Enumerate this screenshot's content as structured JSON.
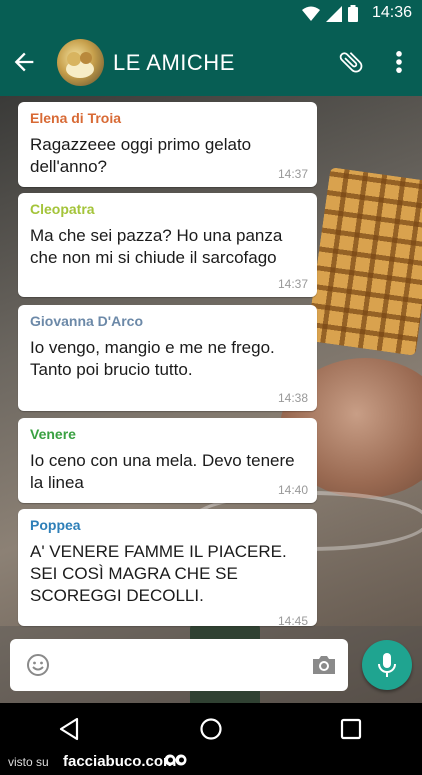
{
  "status_bar": {
    "time": "14:36",
    "icons": [
      "wifi-icon",
      "signal-icon",
      "battery-icon"
    ]
  },
  "header": {
    "title": "LE AMICHE",
    "icons": [
      "back-arrow-icon",
      "group-avatar",
      "attach-icon",
      "more-vert-icon"
    ]
  },
  "messages": [
    {
      "sender": "Elena di Troia",
      "sender_color": "#d86a35",
      "text": "Ragazzeee oggi primo gelato dell'anno?",
      "time": "14:37"
    },
    {
      "sender": "Cleopatra",
      "sender_color": "#a4c43a",
      "text": "Ma che sei pazza? Ho una panza che non mi si chiude il sarcofago",
      "time": "14:37"
    },
    {
      "sender": "Giovanna D'Arco",
      "sender_color": "#6c89a8",
      "text": "Io vengo, mangio e me ne frego. Tanto poi brucio tutto.",
      "time": "14:38"
    },
    {
      "sender": "Venere",
      "sender_color": "#3aa142",
      "text": "Io ceno con una mela. Devo tenere la linea",
      "time": "14:40"
    },
    {
      "sender": "Poppea",
      "sender_color": "#2e7fb8",
      "text": "A' VENERE FAMME IL PIACERE. SEI COSÌ MAGRA CHE SE SCOREGGI DECOLLI.",
      "time": "14:45"
    }
  ],
  "composer": {
    "icons": [
      "emoji-icon",
      "camera-icon",
      "mic-icon"
    ],
    "accent": "#1fa490"
  },
  "nav": {
    "icons": [
      "nav-back-icon",
      "nav-home-icon",
      "nav-recents-icon"
    ]
  },
  "watermark": {
    "prefix": "visto su",
    "site": "facciabuco.com"
  },
  "colors": {
    "primary": "#075e54",
    "bubble": "#ffffff"
  }
}
